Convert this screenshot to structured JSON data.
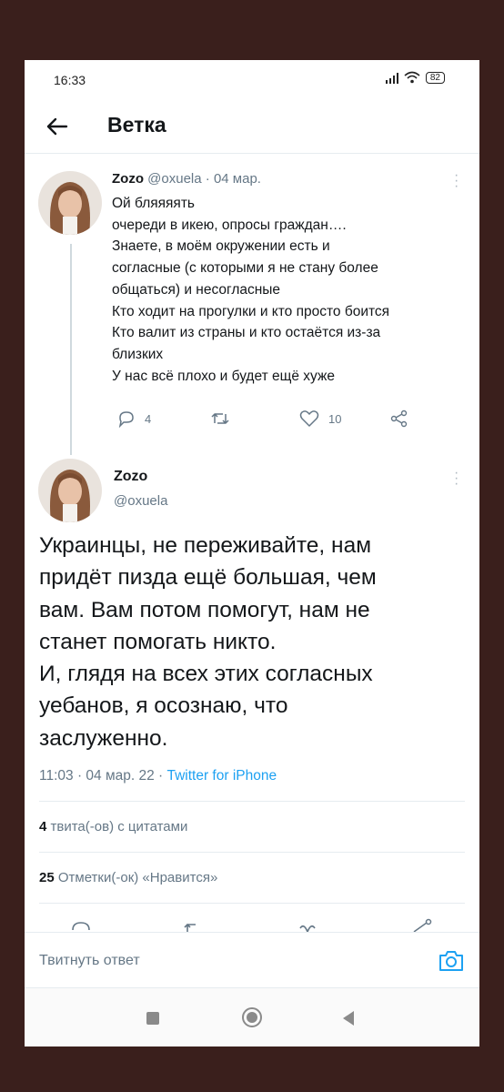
{
  "status": {
    "time": "16:33",
    "battery": "82"
  },
  "header": {
    "title": "Ветка"
  },
  "tweet1": {
    "name": "Zozo",
    "handle": "@oxuela",
    "sep": "·",
    "date": "04 мар.",
    "lines": [
      "Ой бляяяять",
      "очереди в икею, опросы граждан….",
      "Знаете, в моём окружении есть и",
      "согласные (с которыми я не стану более",
      "общаться) и несогласные",
      "Кто ходит на прогулки и кто просто боится",
      "Кто валит из страны и кто остаётся из-за",
      "близких",
      "У нас всё плохо и будет ещё хуже"
    ],
    "replies": "4",
    "likes": "10"
  },
  "tweet2": {
    "name": "Zozo",
    "handle": "@oxuela",
    "lines": [
      "Украинцы, не переживайте, нам",
      "придёт пизда ещё большая, чем",
      "вам. Вам потом помогут, нам не",
      "станет помогать никто.",
      "И, глядя на всех этих согласных",
      "уебанов, я осознаю, что",
      "заслуженно."
    ],
    "timestamp": "11:03 · 04 мар. 22 · ",
    "source": "Twitter for iPhone",
    "quotes_count": "4",
    "quotes_label": " твита(-ов) с цитатами",
    "likes_count": "25",
    "likes_label": " Отметки(-ок) «Нравится»"
  },
  "reply": {
    "placeholder": "Твитнуть ответ"
  },
  "colors": {
    "accent": "#1da1f2",
    "text": "#14171a",
    "muted": "#657786",
    "frame": "#3a1f1c"
  },
  "icons": [
    "back-arrow-icon",
    "reply-icon",
    "retweet-icon",
    "like-icon",
    "share-icon",
    "camera-icon",
    "kebab-icon"
  ]
}
